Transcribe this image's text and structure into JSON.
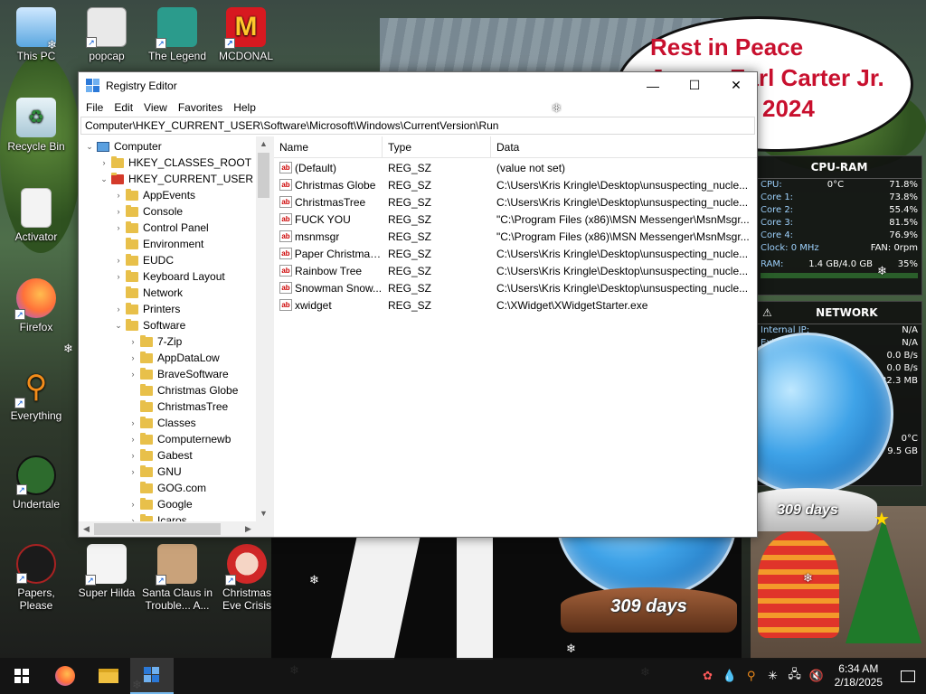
{
  "desktop": {
    "icons": [
      {
        "label": "This PC"
      },
      {
        "label": "popcap"
      },
      {
        "label": "The Legend"
      },
      {
        "label": "MCDONAL"
      },
      {
        "label": "Recycle Bin"
      },
      {
        "label": "Activator"
      },
      {
        "label": "Firefox"
      },
      {
        "label": "Everything"
      },
      {
        "label": "Undertale"
      },
      {
        "label": "Papers, Please"
      },
      {
        "label": "Super Hilda"
      },
      {
        "label": "Santa Claus in Trouble... A..."
      },
      {
        "label": "Christmas Eve Crisis"
      }
    ],
    "rip": {
      "line1": "Rest in Peace",
      "line2": "James Earl Carter Jr.",
      "line3": "2024"
    },
    "globes": {
      "days_label_right": "309 days",
      "days_label_left": "309 days"
    },
    "gadget": {
      "cpu_header": "CPU-RAM",
      "cpu_temp": "0°C",
      "cpu_total": "71.8%",
      "cores": [
        {
          "label": "Core 1:",
          "value": "73.8%"
        },
        {
          "label": "Core 2:",
          "value": "55.4%"
        },
        {
          "label": "Core 3:",
          "value": "81.5%"
        },
        {
          "label": "Core 4:",
          "value": "76.9%"
        }
      ],
      "clock_label": "Clock: 0 MHz",
      "fan_label": "FAN: 0rpm",
      "ram_label": "RAM:",
      "ram_value": "1.4 GB/4.0 GB",
      "ram_pct": "35%",
      "net_header": "NETWORK",
      "internal_ip_label": "Internal IP:",
      "internal_ip": "N/A",
      "external_ip_label": "External IP:",
      "external_ip": "N/A",
      "down_speed": "0.0 B/s",
      "up_speed": "0.0 B/s",
      "total": "22.3 MB",
      "hdd_temp": "0°C",
      "hdd_free": "9.5 GB"
    }
  },
  "window": {
    "title": "Registry Editor",
    "controls": {
      "minimize": "—",
      "maximize": "☐",
      "close": "✕"
    },
    "menu": [
      "File",
      "Edit",
      "View",
      "Favorites",
      "Help"
    ],
    "address": "Computer\\HKEY_CURRENT_USER\\Software\\Microsoft\\Windows\\CurrentVersion\\Run",
    "tree": [
      {
        "label": "Computer"
      },
      {
        "label": "HKEY_CLASSES_ROOT"
      },
      {
        "label": "HKEY_CURRENT_USER"
      },
      {
        "label": "AppEvents"
      },
      {
        "label": "Console"
      },
      {
        "label": "Control Panel"
      },
      {
        "label": "Environment"
      },
      {
        "label": "EUDC"
      },
      {
        "label": "Keyboard Layout"
      },
      {
        "label": "Network"
      },
      {
        "label": "Printers"
      },
      {
        "label": "Software"
      },
      {
        "label": "7-Zip"
      },
      {
        "label": "AppDataLow"
      },
      {
        "label": "BraveSoftware"
      },
      {
        "label": "Christmas Globe"
      },
      {
        "label": "ChristmasTree"
      },
      {
        "label": "Classes"
      },
      {
        "label": "Computernewb"
      },
      {
        "label": "Gabest"
      },
      {
        "label": "GNU"
      },
      {
        "label": "GOG.com"
      },
      {
        "label": "Google"
      },
      {
        "label": "Icaros"
      }
    ],
    "columns": {
      "name": "Name",
      "type": "Type",
      "data": "Data"
    },
    "values": [
      {
        "name": "(Default)",
        "type": "REG_SZ",
        "data": "(value not set)"
      },
      {
        "name": "Christmas Globe",
        "type": "REG_SZ",
        "data": "C:\\Users\\Kris Kringle\\Desktop\\unsuspecting_nucle..."
      },
      {
        "name": "ChristmasTree",
        "type": "REG_SZ",
        "data": "C:\\Users\\Kris Kringle\\Desktop\\unsuspecting_nucle..."
      },
      {
        "name": "FUCK YOU",
        "type": "REG_SZ",
        "data": "\"C:\\Program Files (x86)\\MSN Messenger\\MsnMsgr..."
      },
      {
        "name": "msnmsgr",
        "type": "REG_SZ",
        "data": "\"C:\\Program Files (x86)\\MSN Messenger\\MsnMsgr..."
      },
      {
        "name": "Paper Christmas...",
        "type": "REG_SZ",
        "data": "C:\\Users\\Kris Kringle\\Desktop\\unsuspecting_nucle..."
      },
      {
        "name": "Rainbow Tree",
        "type": "REG_SZ",
        "data": "C:\\Users\\Kris Kringle\\Desktop\\unsuspecting_nucle..."
      },
      {
        "name": "Snowman Snow...",
        "type": "REG_SZ",
        "data": "C:\\Users\\Kris Kringle\\Desktop\\unsuspecting_nucle..."
      },
      {
        "name": "xwidget",
        "type": "REG_SZ",
        "data": "C:\\XWidget\\XWidgetStarter.exe"
      }
    ]
  },
  "taskbar": {
    "time": "6:34 AM",
    "date": "2/18/2025"
  },
  "colors": {
    "accent": "#0078d7",
    "rip_red": "#c8102e",
    "taskbar": "#141414"
  }
}
